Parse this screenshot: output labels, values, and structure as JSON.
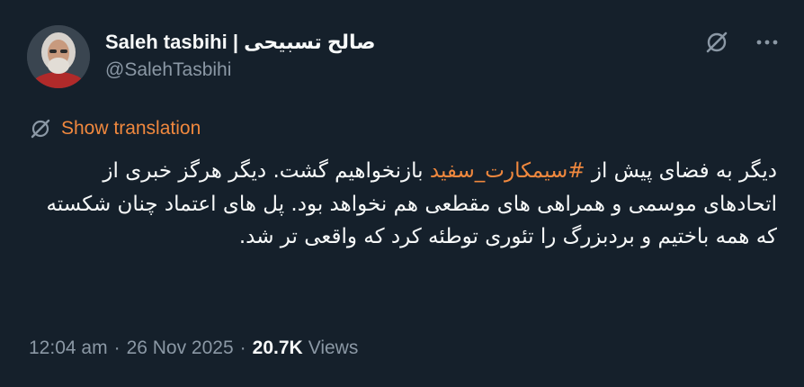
{
  "colors": {
    "background": "#15202b",
    "text_primary": "#f7f9f9",
    "text_secondary": "#8b98a5",
    "accent": "#f0883e"
  },
  "author": {
    "display_name": "Saleh tasbihi | صالح تسبیحی",
    "handle": "@SalehTasbihi",
    "avatar_icon": "profile-photo"
  },
  "actions": {
    "grok_icon": "grok-slash-icon",
    "more_icon": "more-dots-icon"
  },
  "translation": {
    "icon": "translate-slash-icon",
    "label": "Show translation"
  },
  "tweet": {
    "text_before": "دیگر به فضای پیش از ",
    "hashtag": "#سیمکارت_سفید",
    "text_after": " بازنخواهیم گشت. دیگر هرگز خبری از اتحادهای موسمی و همراهی های مقطعی هم نخواهد بود. پل های اعتماد چنان شکسته که همه باختیم و بردبزرگ را تئوری توطئه کرد که واقعی تر شد."
  },
  "meta": {
    "time": "12:04 am",
    "separator": "·",
    "date": "26 Nov 2025",
    "views_count": "20.7K",
    "views_label": "Views"
  }
}
